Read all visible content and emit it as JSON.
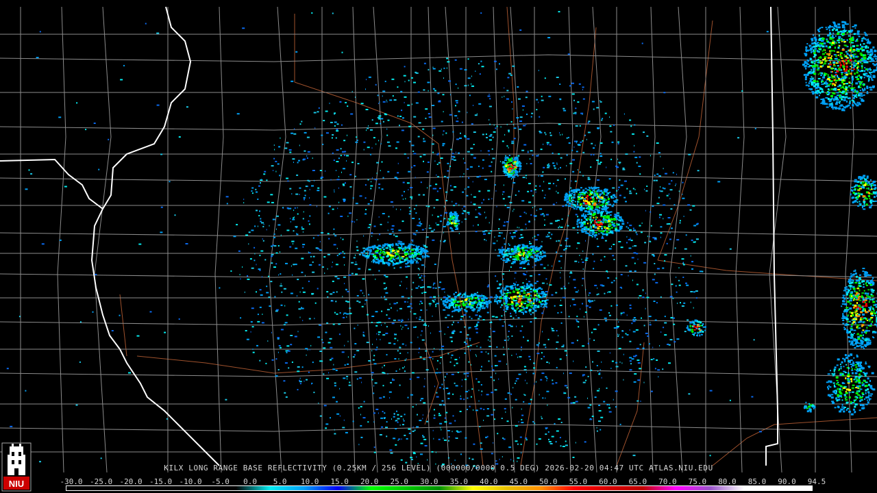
{
  "caption": "KILX LONG RANGE BASE REFLECTIVITY (0.25KM / 256 LEVEL) (000000/0000 0.5 DEG) 2026-02-20 04:47 UTC  ATLAS.NIU.EDU",
  "logo": {
    "text": "NIU",
    "colors": {
      "field": "#cc0000",
      "tower": "#ffffff",
      "frame": "#aaaaaa"
    }
  },
  "scale": {
    "labels": [
      "-30.0",
      "-25.0",
      "-20.0",
      "-15.0",
      "-10.0",
      "-5.0",
      "0.0",
      "5.0",
      "10.0",
      "15.0",
      "20.0",
      "25.0",
      "30.0",
      "35.0",
      "40.0",
      "45.0",
      "50.0",
      "55.0",
      "60.0",
      "65.0",
      "70.0",
      "75.0",
      "80.0",
      "85.0",
      "90.0",
      "94.5"
    ],
    "colors": [
      "#000000",
      "#000000",
      "#000000",
      "#000000",
      "#000000",
      "#000000",
      "#05ecf0",
      "#01a0f6",
      "#0000f6",
      "#00ff00",
      "#00c800",
      "#009000",
      "#ffff00",
      "#e7c000",
      "#ff9000",
      "#ff0000",
      "#d60000",
      "#c00000",
      "#ff00ff",
      "#9955c9",
      "#ffffff",
      "#ffffff",
      "#ffffff"
    ]
  },
  "map": {
    "colors": {
      "background": "#000000",
      "county": "#8c8c8c",
      "state": "#ffffff",
      "road": "#a0522d"
    }
  }
}
